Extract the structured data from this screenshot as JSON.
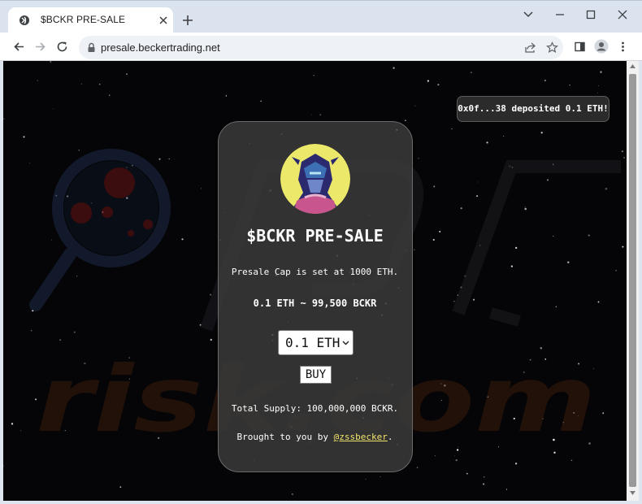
{
  "browser": {
    "tab_title": "$BCKR PRE-SALE",
    "url": "presale.beckertrading.net"
  },
  "page": {
    "toast": "0x0f...38 deposited 0.1 ETH!",
    "title": "$BCKR PRE-SALE",
    "cap_text": "Presale Cap is set at 1000 ETH.",
    "rate_text": "0.1 ETH ~ 99,500 BCKR",
    "amount_select_value": "0.1 ETH",
    "buy_label": "BUY",
    "supply_text": "Total Supply: 100,000,000 BCKR.",
    "credit_prefix": "Brought to you by ",
    "credit_link": "@zssbecker",
    "credit_suffix": "."
  },
  "watermark": "risk.com",
  "colors": {
    "background": "#050507",
    "card": "#3a3a3a",
    "link": "#f2e46a",
    "avatar_bg": "#ece86a"
  }
}
